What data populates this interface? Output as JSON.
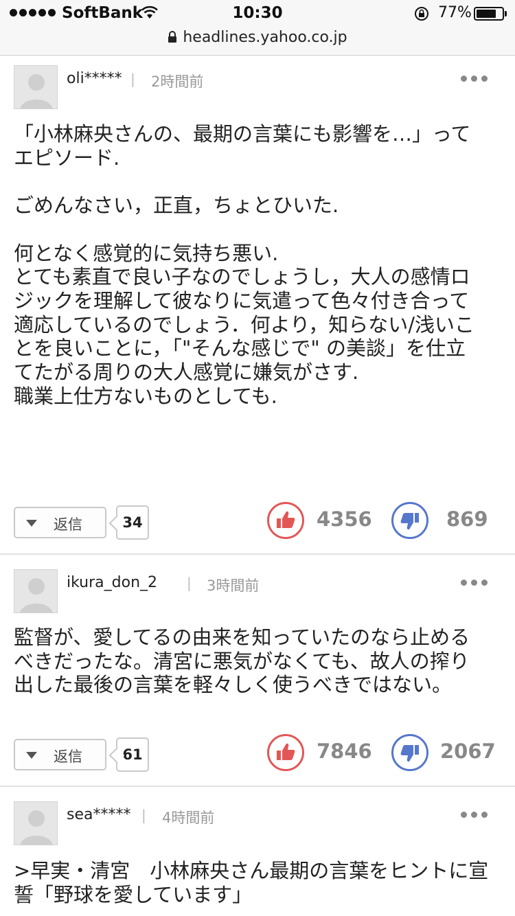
{
  "status_bar": {
    "carrier": "SoftBank",
    "time": "10:30",
    "battery": "77%",
    "battery_level": 0.77
  },
  "url_bar": {
    "host": "headlines.yahoo.co.jp"
  },
  "comments": [
    {
      "username": "oli*****",
      "time_ago": "2時間前",
      "body": "「小林麻央さんの、最期の言葉にも影響を…」って\nエピソード.\n\nごめんなさい，正直，ちょとひいた.\n\n何となく感覚的に気持ち悪い.\nとても素直で良い子なのでしょうし，大人の感情ロ\nジックを理解して彼なりに気遣って色々付き合って\n適応しているのでしょう．何より，知らない/浅いこ\nとを良いことに，「\"そんな感じで\" の美談」を仕立\nてたがる周りの大人感覚に嫌気がさす.\n職業上仕方ないものとしても.",
      "reply_label": "返信",
      "reply_count": "34",
      "likes": "4356",
      "dislikes": "869"
    },
    {
      "username": "ikura_don_2",
      "time_ago": "3時間前",
      "body": "監督が、愛してるの由来を知っていたのなら止める\nべきだったな。清宮に悪気がなくても、故人の搾り\n出した最後の言葉を軽々しく使うべきではない。",
      "reply_label": "返信",
      "reply_count": "61",
      "likes": "7846",
      "dislikes": "2067"
    },
    {
      "username": "sea*****",
      "time_ago": "4時間前",
      "body": ">早実・清宮　小林麻央さん最期の言葉をヒントに宣\n誓「野球を愛しています」"
    }
  ]
}
